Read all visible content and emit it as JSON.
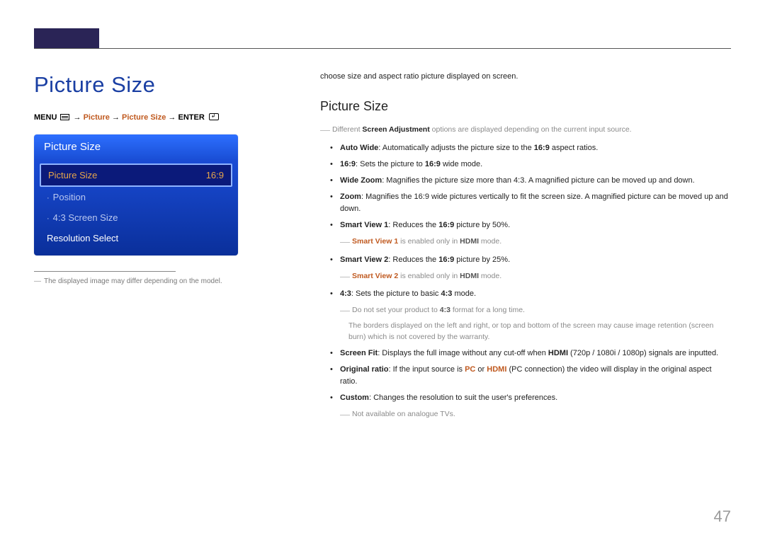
{
  "page_number": "47",
  "main_heading": "Picture Size",
  "breadcrumb": {
    "menu": "MENU",
    "arrow1": " → ",
    "picture": "Picture",
    "arrow2": " → ",
    "picture_size": "Picture Size",
    "arrow3": " → ",
    "enter": "ENTER"
  },
  "osd": {
    "title": "Picture Size",
    "rows": [
      {
        "label": "Picture Size",
        "value": "16:9"
      },
      {
        "label": "Position",
        "value": ""
      },
      {
        "label": "4:3 Screen Size",
        "value": ""
      },
      {
        "label": "Resolution Select",
        "value": ""
      }
    ]
  },
  "footnote": "The displayed image may differ depending on the model.",
  "right": {
    "intro": "choose size and aspect ratio picture displayed on screen.",
    "sub_heading": "Picture Size",
    "note_different_pre": "Different ",
    "note_different_bold": "Screen Adjustment",
    "note_different_post": " options are displayed depending on the current input source.",
    "b_autowide_label": "Auto Wide",
    "b_autowide_text": ": Automatically adjusts the picture size to the ",
    "b_autowide_bold": "16:9",
    "b_autowide_tail": " aspect ratios.",
    "b_169_label": "16:9",
    "b_169_text": ": Sets the picture to ",
    "b_169_bold": "16:9",
    "b_169_tail": " wide mode.",
    "b_widezoom_label": "Wide Zoom",
    "b_widezoom_text": ": Magnifies the picture size more than 4:3. A magnified picture can be moved up and down.",
    "b_zoom_label": "Zoom",
    "b_zoom_text": ": Magnifies the 16:9 wide pictures vertically to fit the screen size. A magnified picture can be moved up and down.",
    "b_sv1_label": "Smart View 1",
    "b_sv1_text": ": Reduces the ",
    "b_sv1_bold": "16:9",
    "b_sv1_tail": " picture by 50%.",
    "sv1_note_hl": "Smart View 1",
    "sv1_note_mid": " is enabled only in ",
    "sv1_note_bold": "HDMI",
    "sv1_note_tail": " mode.",
    "b_sv2_label": "Smart View 2",
    "b_sv2_text": ": Reduces the ",
    "b_sv2_bold": "16:9",
    "b_sv2_tail": " picture by 25%.",
    "sv2_note_hl": "Smart View 2",
    "sv2_note_mid": " is enabled only in ",
    "sv2_note_bold": "HDMI",
    "sv2_note_tail": " mode.",
    "b_43_label": "4:3",
    "b_43_text": ": Sets the picture to basic ",
    "b_43_bold": "4:3",
    "b_43_tail": " mode.",
    "note43_pre": "Do not set your product to ",
    "note43_bold": "4:3",
    "note43_post": " format for a long time.",
    "note43_line2": "The borders displayed on the left and right, or top and bottom of the screen may cause image retention (screen burn) which is not covered by the warranty.",
    "b_screenfit_label": "Screen Fit",
    "b_screenfit_text": ": Displays the full image without any cut-off when ",
    "b_screenfit_bold": "HDMI",
    "b_screenfit_tail": " (720p / 1080i / 1080p) signals are inputted.",
    "b_original_label": "Original ratio",
    "b_original_text": ": If the input source is ",
    "b_original_pc": "PC",
    "b_original_or": " or ",
    "b_original_hdmi": "HDMI",
    "b_original_tail": " (PC connection) the video will display in the original aspect ratio.",
    "b_custom_label": "Custom",
    "b_custom_text": ": Changes the resolution to suit the user's preferences.",
    "custom_note": "Not available on analogue TVs."
  }
}
